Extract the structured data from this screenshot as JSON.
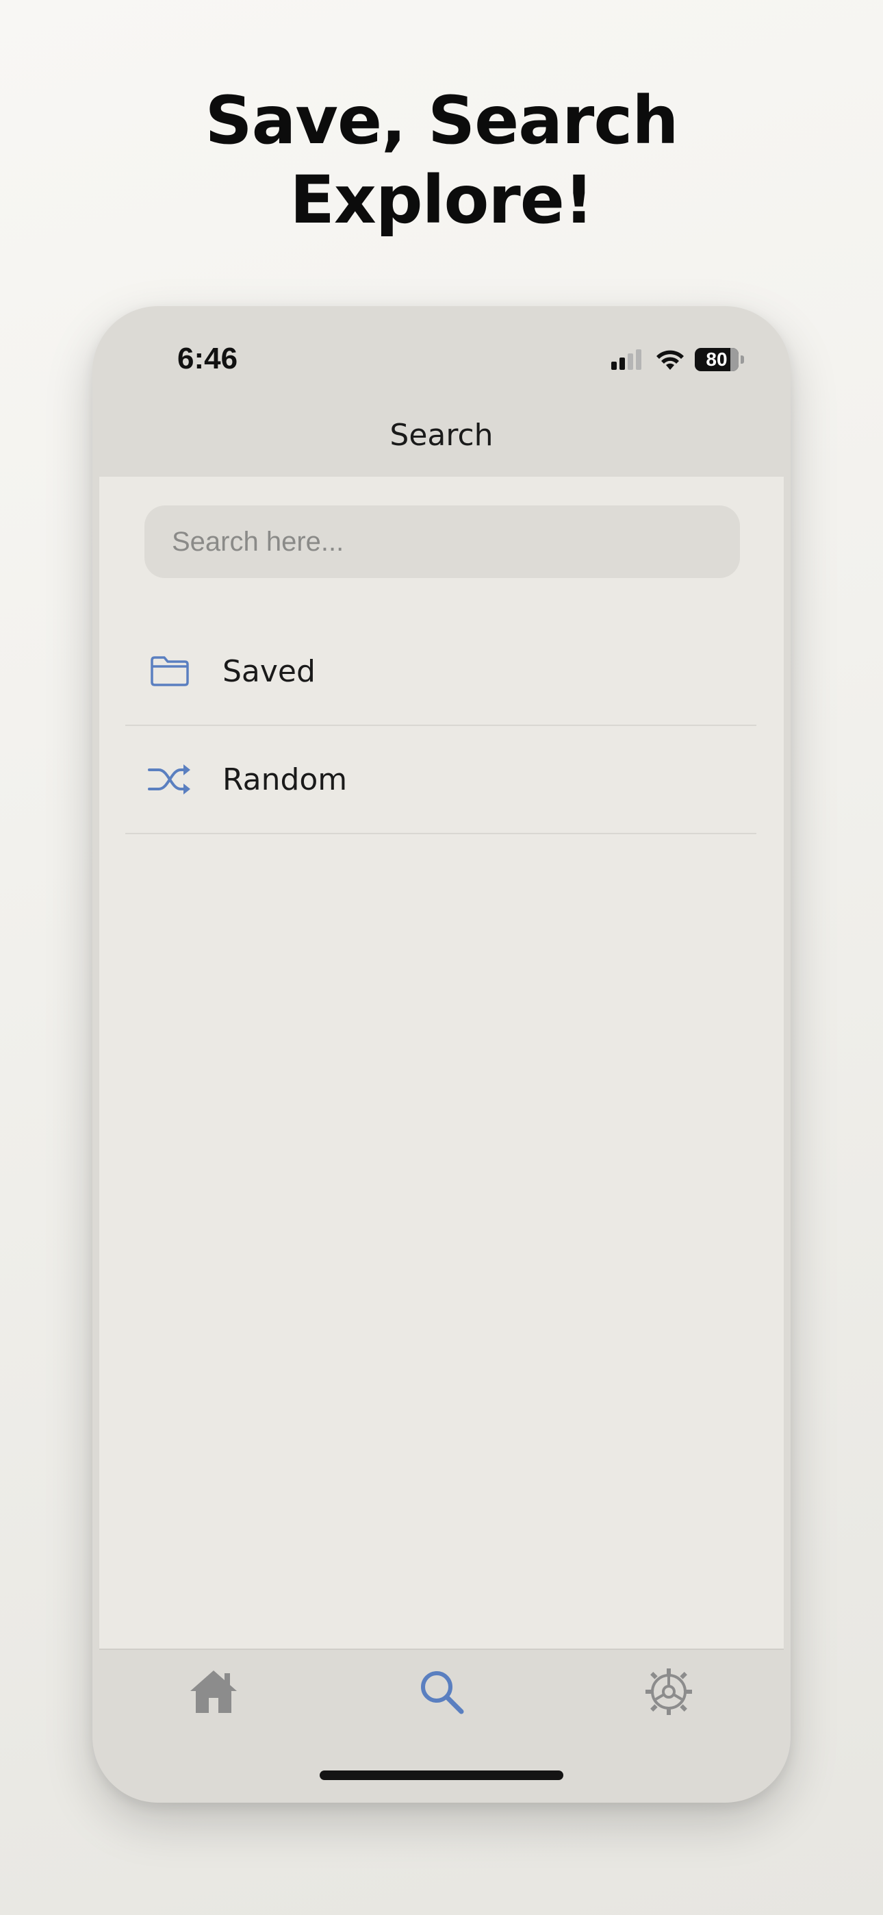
{
  "headline": {
    "line1": "Save, Search",
    "line2": "Explore!"
  },
  "status": {
    "time": "6:46",
    "battery": "80"
  },
  "nav": {
    "title": "Search"
  },
  "search": {
    "placeholder": "Search here...",
    "value": ""
  },
  "list": {
    "items": [
      {
        "label": "Saved",
        "icon": "folder-icon"
      },
      {
        "label": "Random",
        "icon": "shuffle-icon"
      }
    ]
  },
  "tabs": [
    {
      "name": "home",
      "icon": "home-icon",
      "active": false
    },
    {
      "name": "search",
      "icon": "search-icon",
      "active": true
    },
    {
      "name": "settings",
      "icon": "gear-icon",
      "active": false
    }
  ],
  "colors": {
    "accent": "#5a7fc0",
    "inactive_icon": "#8c8c8c",
    "background": "#ebe9e4"
  }
}
